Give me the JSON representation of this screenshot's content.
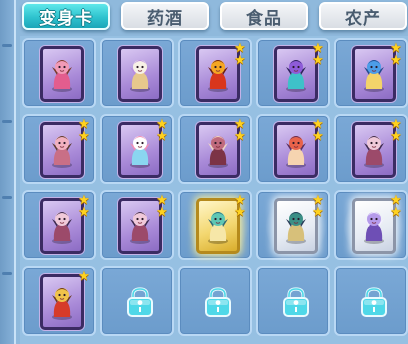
{
  "tabs": [
    {
      "label": "变身卡",
      "active": true
    },
    {
      "label": "药酒",
      "active": false
    },
    {
      "label": "食品",
      "active": false
    },
    {
      "label": "农产",
      "active": false
    }
  ],
  "colors": {
    "active_tab": "#2fc3cf",
    "inactive_tab": "#d9dee4",
    "slot_bg": "#6c9ccc",
    "panel_bg": "#96c0e2",
    "star": "#ffd21f",
    "lock": "#4fd8e8"
  },
  "slots": [
    {
      "type": "card",
      "frame": "purple",
      "stars": 0,
      "figure": "pink-pig-warrior",
      "palette": [
        "#f29ab6",
        "#e35d8e",
        "#7a3a2a"
      ]
    },
    {
      "type": "card",
      "frame": "purple",
      "stars": 0,
      "figure": "white-rabbit-lady",
      "palette": [
        "#f7f1e6",
        "#e7c88c",
        "#b98be0"
      ]
    },
    {
      "type": "card",
      "frame": "purple",
      "stars": 2,
      "figure": "fire-beast",
      "palette": [
        "#f5a623",
        "#d9361c",
        "#6b1f12"
      ]
    },
    {
      "type": "card",
      "frame": "purple",
      "stars": 2,
      "figure": "serpent-mage",
      "palette": [
        "#8e5bd8",
        "#3ec1c9",
        "#2c2359"
      ]
    },
    {
      "type": "card",
      "frame": "purple",
      "stars": 2,
      "figure": "blue-dragon-warrior",
      "palette": [
        "#4c9de8",
        "#f3d36a",
        "#234b8e"
      ]
    },
    {
      "type": "card",
      "frame": "purple",
      "stars": 2,
      "figure": "pink-elephant",
      "palette": [
        "#f2b1bf",
        "#c96f86",
        "#5b3a2e"
      ]
    },
    {
      "type": "card",
      "frame": "purple",
      "stars": 2,
      "figure": "jade-rabbit",
      "palette": [
        "#ffffff",
        "#8ad6f0",
        "#f28cb4"
      ]
    },
    {
      "type": "card",
      "frame": "purple",
      "stars": 2,
      "figure": "bat-demon",
      "palette": [
        "#c06a7d",
        "#7c3346",
        "#f0d5c5"
      ]
    },
    {
      "type": "card",
      "frame": "purple",
      "stars": 2,
      "figure": "red-fox-fighter",
      "palette": [
        "#e8634a",
        "#f6d4b0",
        "#5a2f5e"
      ]
    },
    {
      "type": "card",
      "frame": "purple",
      "stars": 2,
      "figure": "winged-fairy",
      "palette": [
        "#f0c9d9",
        "#9c4a6a",
        "#3d2a4e"
      ]
    },
    {
      "type": "card",
      "frame": "purple",
      "stars": 2,
      "figure": "winged-fairy",
      "palette": [
        "#f0c9d9",
        "#9c4a6a",
        "#3d2a4e"
      ]
    },
    {
      "type": "card",
      "frame": "purple",
      "stars": 2,
      "figure": "winged-fairy",
      "palette": [
        "#f0c9d9",
        "#9c4a6a",
        "#3d2a4e"
      ]
    },
    {
      "type": "card",
      "frame": "gold",
      "stars": 2,
      "figure": "jade-immortal",
      "palette": [
        "#5fc7b4",
        "#f6e7a8",
        "#2e6b7a"
      ]
    },
    {
      "type": "card",
      "frame": "white",
      "stars": 2,
      "figure": "armored-general",
      "palette": [
        "#3b8f86",
        "#d7c07a",
        "#2a3f5a"
      ]
    },
    {
      "type": "card",
      "frame": "white",
      "stars": 2,
      "figure": "violet-qilin",
      "palette": [
        "#b59bea",
        "#6e4fb5",
        "#f4f0ff"
      ]
    },
    {
      "type": "card",
      "frame": "purple",
      "stars": 1,
      "figure": "monkey-king",
      "palette": [
        "#f0c34a",
        "#d63b2a",
        "#6b3a1f"
      ]
    },
    {
      "type": "locked",
      "icon": "lock-icon"
    },
    {
      "type": "locked",
      "icon": "lock-icon"
    },
    {
      "type": "locked",
      "icon": "lock-icon"
    },
    {
      "type": "locked",
      "icon": "lock-icon"
    }
  ]
}
